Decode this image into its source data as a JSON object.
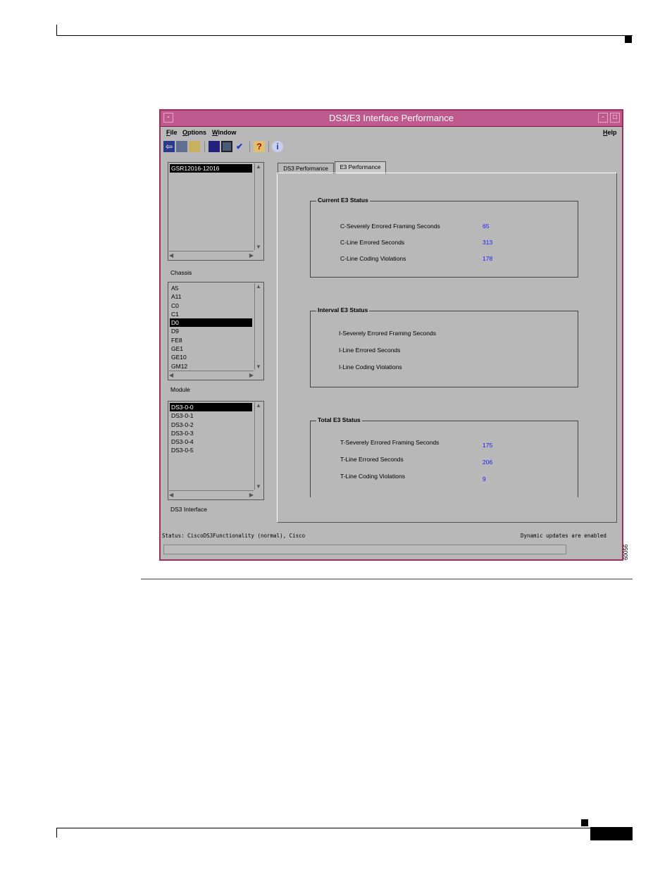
{
  "window": {
    "title": "DS3/E3 Interface Performance",
    "title_controls": {
      "minimize": "-",
      "maximize": "□"
    },
    "menu": {
      "file": "File",
      "options": "Options",
      "window": "Window",
      "help": "Help"
    },
    "toolbar_icons": [
      "exit-icon",
      "deploy-icon",
      "print-icon",
      "list-icon",
      "monitor-icon",
      "check-icon",
      "help-icon",
      "info-icon"
    ],
    "toolbar_glyphs": {
      "help": "?",
      "info": "i",
      "check": "✔"
    }
  },
  "chassis": {
    "label": "Chassis",
    "items": [
      "GSR12016-12016"
    ],
    "selected": "GSR12016-12016"
  },
  "module": {
    "label": "Module",
    "items": [
      "A5",
      "A11",
      "C0",
      "C1",
      "D0",
      "D9",
      "FE8",
      "GE1",
      "GE10",
      "GM12"
    ],
    "selected": "D0"
  },
  "ds3_interface": {
    "label": "DS3 Interface",
    "items": [
      "DS3-0-0",
      "DS3-0-1",
      "DS3-0-2",
      "DS3-0-3",
      "DS3-0-4",
      "DS3-0-5"
    ],
    "selected": "DS3-0-0"
  },
  "tabs": [
    {
      "label": "DS3 Performance",
      "active": false
    },
    {
      "label": "E3 Performance",
      "active": true
    }
  ],
  "current_e3": {
    "title": "Current E3 Status",
    "rows": [
      {
        "label": "C-Severely Errored Framing Seconds",
        "value": "65"
      },
      {
        "label": "C-Line Errored Seconds",
        "value": "313"
      },
      {
        "label": "C-Line Coding Violations",
        "value": "178"
      }
    ]
  },
  "interval_e3": {
    "title": "Interval E3 Status",
    "rows": [
      {
        "label": "I-Severely Errored Framing Seconds",
        "value": ""
      },
      {
        "label": "I-Line Errored Seconds",
        "value": ""
      },
      {
        "label": "I-Line Coding Violations",
        "value": ""
      }
    ]
  },
  "total_e3": {
    "title": "Total E3 Status",
    "rows": [
      {
        "label": "T-Severely Errored Framing Seconds",
        "value": "175"
      },
      {
        "label": "T-Line Errored Seconds",
        "value": "206"
      },
      {
        "label": "T-Line Coding Violations",
        "value": "9"
      }
    ]
  },
  "status": {
    "left": "Status: CiscoDS3Functionality (normal), Cisco",
    "right": "Dynamic updates are enabled"
  },
  "figure_id": "60056",
  "colors": {
    "titlebar": "#c05a8e",
    "window_border": "#9b2f5f",
    "value_text": "#1a1aff",
    "panel": "#b8b8b8"
  }
}
